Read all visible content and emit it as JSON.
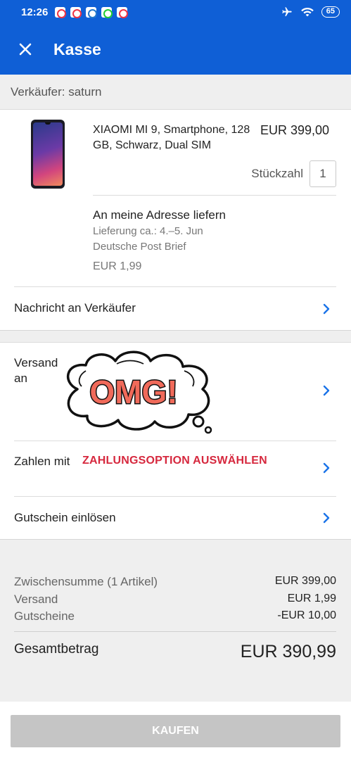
{
  "status_bar": {
    "time": "12:26",
    "battery": "65"
  },
  "header": {
    "title": "Kasse"
  },
  "seller": {
    "label": "Verkäufer: saturn"
  },
  "item": {
    "name": "XIAOMI MI 9, Smartphone, 128 GB, Schwarz, Dual SIM",
    "price": "EUR 399,00",
    "quantity_label": "Stückzahl",
    "quantity": "1"
  },
  "shipping_option": {
    "title": "An meine Adresse liefern",
    "delivery": "Lieferung ca.: 4.–5. Jun",
    "carrier": "Deutsche Post Brief",
    "cost": "EUR 1,99"
  },
  "message_row": {
    "label": "Nachricht an Verkäufer"
  },
  "ship_to": {
    "label": "Versand an",
    "sticker": "OMG!"
  },
  "payment": {
    "label": "Zahlen mit",
    "cta": "ZAHLUNGSOPTION AUSWÄHLEN"
  },
  "voucher": {
    "label": "Gutschein einlösen"
  },
  "summary": {
    "rows": [
      {
        "label": "Zwischensumme (1 Artikel)",
        "value": "EUR 399,00"
      },
      {
        "label": "Versand",
        "value": "EUR 1,99"
      },
      {
        "label": "Gutscheine",
        "value": "-EUR 10,00"
      }
    ],
    "total_label": "Gesamtbetrag",
    "total_value": "EUR 390,99"
  },
  "footer": {
    "buy_label": "KAUFEN"
  },
  "colors": {
    "brand_blue": "#0f5fd6",
    "cta_red": "#d6283e",
    "disabled_button": "#c5c5c5"
  }
}
